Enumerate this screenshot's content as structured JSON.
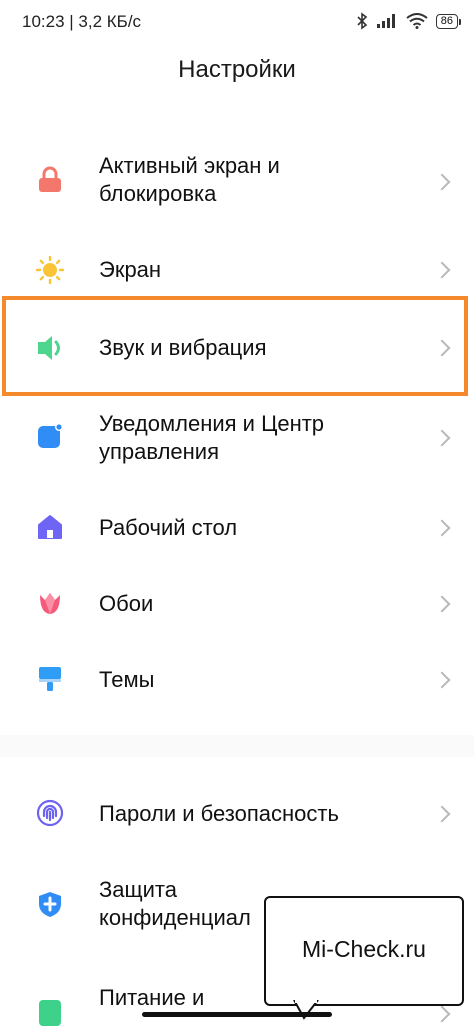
{
  "status_bar": {
    "time_speed": "10:23 | 3,2 КБ/с",
    "battery": "86"
  },
  "header": {
    "title": "Настройки"
  },
  "settings": [
    {
      "label": "Активный экран и блокировка",
      "icon": "lock-icon",
      "color": "#f3786b"
    },
    {
      "label": "Экран",
      "icon": "sun-icon",
      "color": "#fbc437"
    },
    {
      "label": "Звук и вибрация",
      "icon": "speaker-icon",
      "color": "#4cd68e"
    },
    {
      "label": "Уведомления и Центр управления",
      "icon": "notification-icon",
      "color": "#2f8df5"
    },
    {
      "label": "Рабочий стол",
      "icon": "home-icon",
      "color": "#6e65f6"
    },
    {
      "label": "Обои",
      "icon": "tulip-icon",
      "color": "#f55a7a"
    },
    {
      "label": "Темы",
      "icon": "paint-roller-icon",
      "color": "#2f9cf5"
    },
    {
      "label": "Пароли и безопасность",
      "icon": "fingerprint-icon",
      "color": "#6c63f0"
    },
    {
      "label": "Защита конфиденциал",
      "icon": "shield-icon",
      "color": "#2f8df5"
    },
    {
      "label": "Питание и",
      "icon": "battery-icon",
      "color": "#3dd18a"
    }
  ],
  "watermark": {
    "text": "Mi-Check.ru"
  },
  "colors": {
    "highlight": "#f48a2c"
  }
}
